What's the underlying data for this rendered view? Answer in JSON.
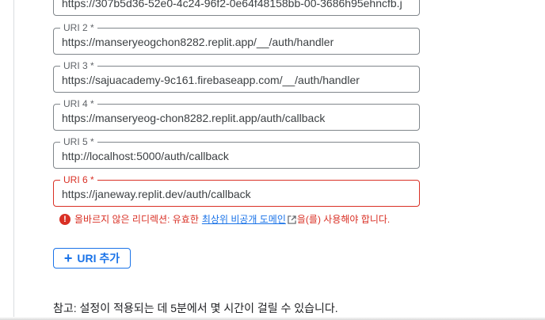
{
  "uris": [
    {
      "label": "",
      "value": "https://307b5d36-52e0-4c24-96f2-0e64f48158bb-00-3686h95ehncfb.j",
      "error": false
    },
    {
      "label": "URI 2 *",
      "value": "https://manseryeogchon8282.replit.app/__/auth/handler",
      "error": false
    },
    {
      "label": "URI 3 *",
      "value": "https://sajuacademy-9c161.firebaseapp.com/__/auth/handler",
      "error": false
    },
    {
      "label": "URI 4 *",
      "value": "https://manseryeog-chon8282.replit.app/auth/callback",
      "error": false
    },
    {
      "label": "URI 5 *",
      "value": "http://localhost:5000/auth/callback",
      "error": false
    },
    {
      "label": "URI 6 *",
      "value": "https://janeway.replit.dev/auth/callback",
      "error": true
    }
  ],
  "error": {
    "icon": "error-icon",
    "prefix": "올바르지 않은 리디렉션: 유효한",
    "link": "최상위 비공개 도메인",
    "suffix": "을(를) 사용해야 합니다."
  },
  "add_button": {
    "icon": "plus-icon",
    "label": "URI 추가"
  },
  "note": "참고: 설정이 적용되는 데 5분에서 몇 시간이 걸릴 수 있습니다.",
  "colors": {
    "error": "#d93025",
    "accent": "#1a73e8",
    "border": "#80868b"
  }
}
